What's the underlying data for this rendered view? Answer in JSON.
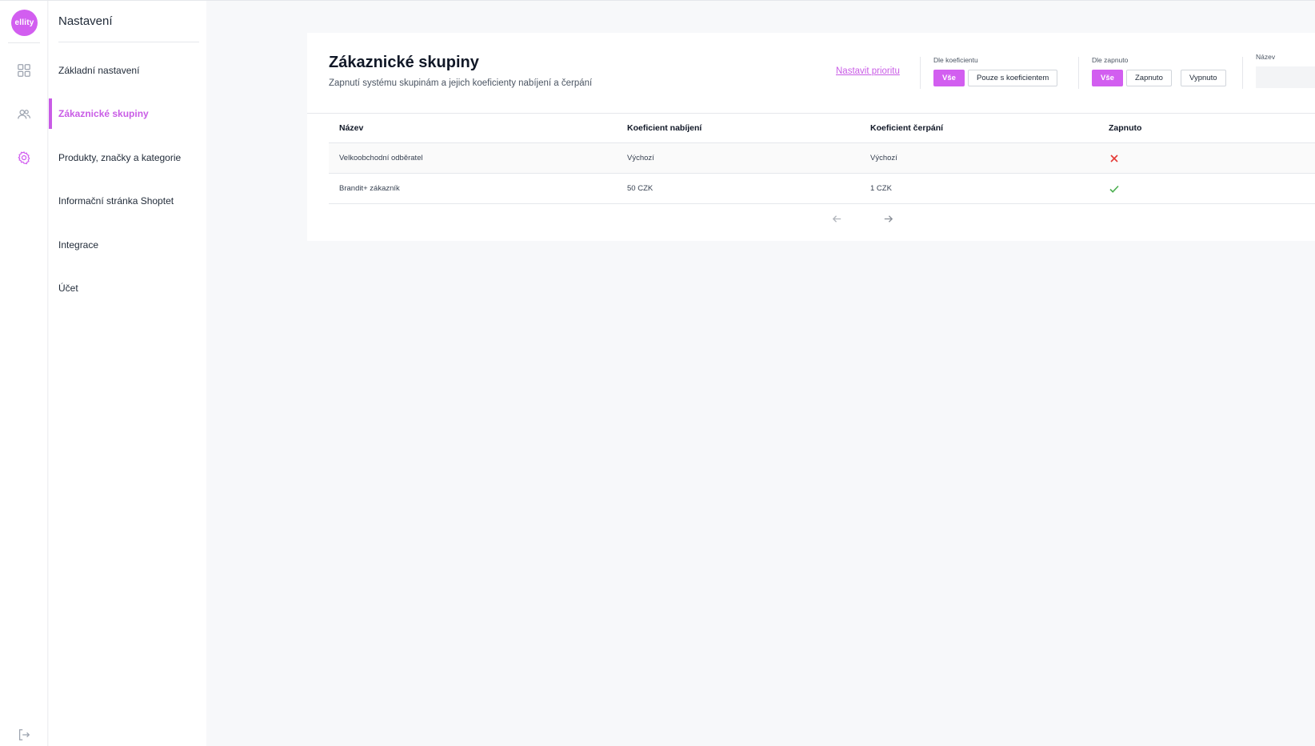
{
  "brand": {
    "logo_text": "ellity",
    "accent": "#d25ef0"
  },
  "rail": {
    "icons": [
      "dashboard-icon",
      "users-icon",
      "settings-icon"
    ],
    "bottom_icon": "logout-icon"
  },
  "sidebar": {
    "title": "Nastavení",
    "items": [
      {
        "label": "Základní nastavení",
        "active": false
      },
      {
        "label": "Zákaznické skupiny",
        "active": true
      },
      {
        "label": "Produkty, značky a kategorie",
        "active": false
      },
      {
        "label": "Informační stránka Shoptet",
        "active": false
      },
      {
        "label": "Integrace",
        "active": false
      },
      {
        "label": "Účet",
        "active": false
      }
    ]
  },
  "page": {
    "title": "Zákaznické skupiny",
    "subtitle": "Zapnutí systému skupinám a jejich koeficienty nabíjení a čerpání",
    "priority_link": "Nastavit prioritu"
  },
  "filters": {
    "by_coefficient": {
      "label": "Dle koeficientu",
      "options": [
        "Vše",
        "Pouze s koeficientem"
      ],
      "selected": "Vše"
    },
    "by_enabled": {
      "label": "Dle zapnuto",
      "options": [
        "Vše",
        "Zapnuto",
        "Vypnuto"
      ],
      "selected": "Vše"
    },
    "name": {
      "label": "Název",
      "value": ""
    }
  },
  "table": {
    "columns": [
      "Název",
      "Koeficient nabíjení",
      "Koeficient čerpání",
      "Zapnuto"
    ],
    "rows": [
      {
        "name": "Velkoobchodní odběratel",
        "charge": "Výchozí",
        "spend": "Výchozí",
        "enabled": false
      },
      {
        "name": "Brandit+ zákazník",
        "charge": "50 CZK",
        "spend": "1 CZK",
        "enabled": true
      }
    ]
  },
  "colors": {
    "enabled": "#4caf50",
    "disabled": "#e53935"
  }
}
